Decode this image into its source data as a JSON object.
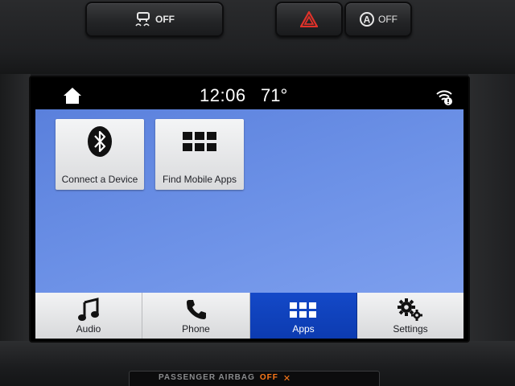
{
  "hardware_buttons": {
    "traction_control": {
      "label": "OFF"
    },
    "hazard": {},
    "auto_start_stop": {
      "label": "OFF"
    }
  },
  "status_bar": {
    "time": "12:06",
    "temperature": "71°"
  },
  "tiles": [
    {
      "label": "Connect a Device",
      "icon": "bluetooth-icon"
    },
    {
      "label": "Find Mobile Apps",
      "icon": "app-grid-icon"
    }
  ],
  "navbar": {
    "active": "Apps",
    "items": [
      {
        "label": "Audio",
        "icon": "music-note-icon"
      },
      {
        "label": "Phone",
        "icon": "phone-icon"
      },
      {
        "label": "Apps",
        "icon": "app-grid-icon"
      },
      {
        "label": "Settings",
        "icon": "gears-icon"
      }
    ]
  },
  "airbag_panel": {
    "label": "PASSENGER AIRBAG",
    "status": "OFF"
  },
  "colors": {
    "content_background": "#6b90e6",
    "active_tab": "#1449c8",
    "hazard_red": "#e0322a",
    "airbag_status": "#ff7a1a"
  }
}
